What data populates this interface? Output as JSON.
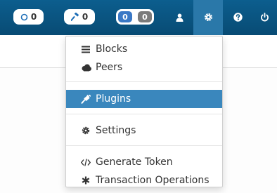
{
  "topbar": {
    "circle_count": "0",
    "hammer_count": "0",
    "tx_blue_count": "0",
    "tx_gray_count": "0",
    "icons": [
      "circle-icon",
      "hammer-icon",
      "user-icon",
      "gear-icon",
      "help-icon",
      "power-icon"
    ]
  },
  "dropdown": {
    "blocks_label": "Blocks",
    "peers_label": "Peers",
    "plugins_label": "Plugins",
    "settings_label": "Settings",
    "generate_token_label": "Generate Token",
    "transaction_operations_label": "Transaction Operations",
    "active_item": "Plugins"
  },
  "colors": {
    "topbar": "#0c5e8e",
    "active_nav": "#2a78a9",
    "active_item": "#3a87bd"
  }
}
